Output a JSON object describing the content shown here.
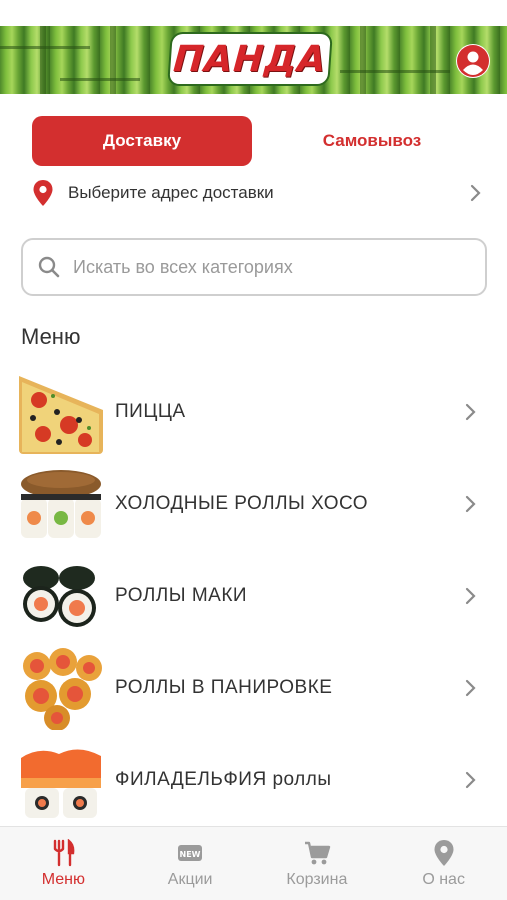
{
  "header": {
    "logo_text": "ПАНДА",
    "profile_icon": "user-circle-icon",
    "brand_color": "#d32f2f"
  },
  "order_mode": {
    "delivery_label": "Доставку",
    "pickup_label": "Самовывоз",
    "selected": "delivery"
  },
  "address": {
    "pin_icon": "location-pin-icon",
    "text": "Выберите адрес доставки"
  },
  "search": {
    "placeholder": "Искать во всех категориях",
    "value": ""
  },
  "menu": {
    "title": "Меню",
    "items": [
      {
        "label": "ПИЦЦА",
        "thumb": "pizza"
      },
      {
        "label": "ХОЛОДНЫЕ РОЛЛЫ ХОСО",
        "thumb": "hoso-rolls"
      },
      {
        "label": " РОЛЛЫ МАКИ",
        "thumb": "maki-rolls"
      },
      {
        "label": "РОЛЛЫ В ПАНИРОВКЕ",
        "thumb": "breaded-rolls"
      },
      {
        "label": "ФИЛАДЕЛЬФИЯ роллы",
        "thumb": "philadelphia-rolls"
      }
    ]
  },
  "tabbar": {
    "tabs": [
      {
        "label": "Меню",
        "icon": "fork-knife-icon",
        "active": true
      },
      {
        "label": "Акции",
        "icon": "new-badge-icon",
        "active": false
      },
      {
        "label": "Корзина",
        "icon": "cart-icon",
        "active": false
      },
      {
        "label": "О нас",
        "icon": "location-pin-icon",
        "active": false
      }
    ]
  }
}
